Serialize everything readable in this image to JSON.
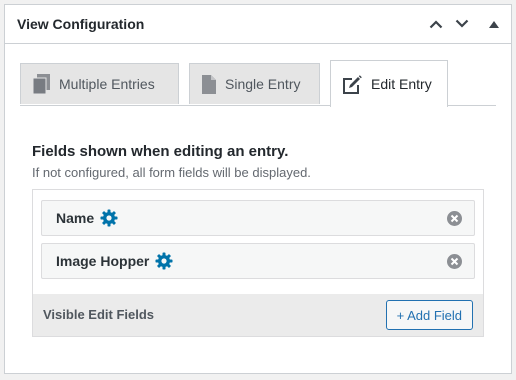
{
  "panel": {
    "title": "View Configuration",
    "controls": [
      "chevron-up-icon",
      "chevron-down-icon",
      "triangle-up-icon"
    ]
  },
  "tabs": [
    {
      "label": "Multiple Entries",
      "icon": "multiple-entries-icon",
      "active": false
    },
    {
      "label": "Single Entry",
      "icon": "single-entry-icon",
      "active": false
    },
    {
      "label": "Edit Entry",
      "icon": "edit-entry-icon",
      "active": true
    }
  ],
  "section": {
    "title": "Fields shown when editing an entry.",
    "description": "If not configured, all form fields will be displayed."
  },
  "fields": [
    {
      "label": "Name"
    },
    {
      "label": "Image Hopper"
    }
  ],
  "footer": {
    "label": "Visible Edit Fields",
    "add_button": "+ Add Field"
  },
  "colors": {
    "accent": "#2271b1",
    "gear": "#0073aa",
    "remove": "#8c8f94"
  }
}
